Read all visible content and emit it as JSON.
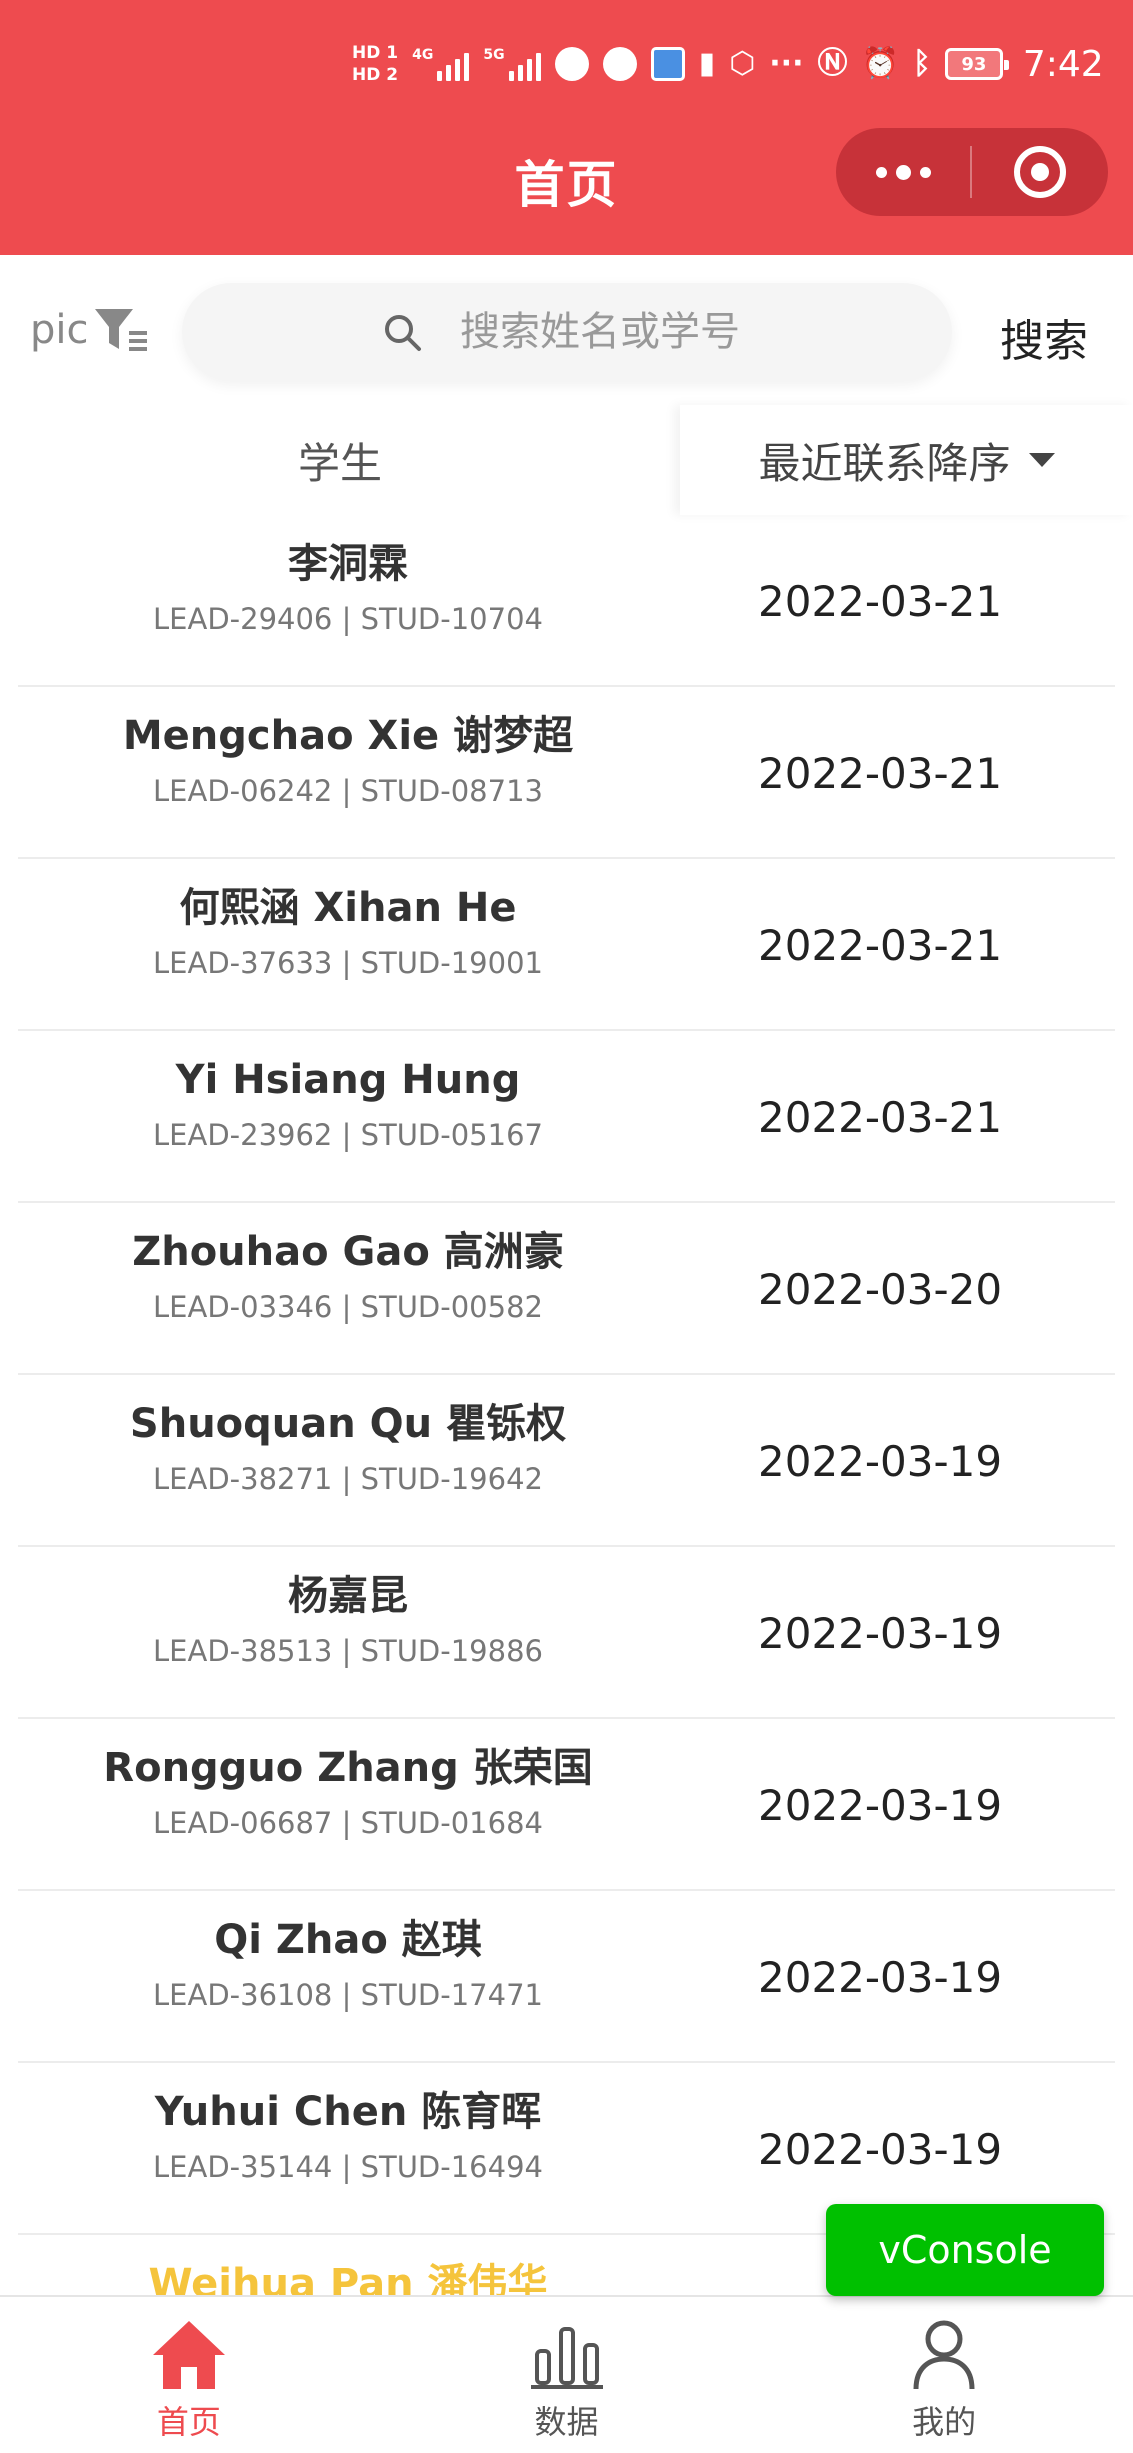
{
  "status_bar": {
    "hd1": "HD 1",
    "hd2": "HD 2",
    "net1": "4G",
    "net2": "5G",
    "battery": "93",
    "time": "7:42"
  },
  "header": {
    "title": "首页",
    "color": "#ee4b4f"
  },
  "filter": {
    "label": "pic"
  },
  "search": {
    "placeholder": "搜索姓名或学号",
    "button": "搜索"
  },
  "columns": {
    "student": "学生",
    "sort": "最近联系降序"
  },
  "students": [
    {
      "name": "李洞霖",
      "ids": "LEAD-29406 | STUD-10704",
      "date": "2022-03-21"
    },
    {
      "name": "Mengchao Xie 谢梦超",
      "ids": "LEAD-06242 | STUD-08713",
      "date": "2022-03-21"
    },
    {
      "name": "何熙涵 Xihan He",
      "ids": "LEAD-37633 | STUD-19001",
      "date": "2022-03-21"
    },
    {
      "name": "Yi Hsiang Hung",
      "ids": "LEAD-23962 | STUD-05167",
      "date": "2022-03-21"
    },
    {
      "name": "Zhouhao Gao 高洲豪",
      "ids": "LEAD-03346 | STUD-00582",
      "date": "2022-03-20"
    },
    {
      "name": "Shuoquan Qu 瞿铄权",
      "ids": "LEAD-38271 | STUD-19642",
      "date": "2022-03-19"
    },
    {
      "name": "杨嘉昆",
      "ids": "LEAD-38513 | STUD-19886",
      "date": "2022-03-19"
    },
    {
      "name": "Rongguo Zhang 张荣国",
      "ids": "LEAD-06687 | STUD-01684",
      "date": "2022-03-19"
    },
    {
      "name": "Qi Zhao 赵琪",
      "ids": "LEAD-36108 | STUD-17471",
      "date": "2022-03-19"
    },
    {
      "name": "Yuhui Chen 陈育晖",
      "ids": "LEAD-35144 | STUD-16494",
      "date": "2022-03-19"
    },
    {
      "name": "Weihua Pan 潘伟华",
      "ids": "",
      "date": ""
    }
  ],
  "vconsole": {
    "label": "vConsole",
    "color": "#00c000"
  },
  "tabbar": {
    "home": "首页",
    "data": "数据",
    "mine": "我的",
    "active_color": "#ee4b4f"
  },
  "icons": {
    "filter": "filter-icon",
    "search": "search-icon",
    "home": "home-icon",
    "data": "bar-chart-icon",
    "mine": "person-icon"
  }
}
